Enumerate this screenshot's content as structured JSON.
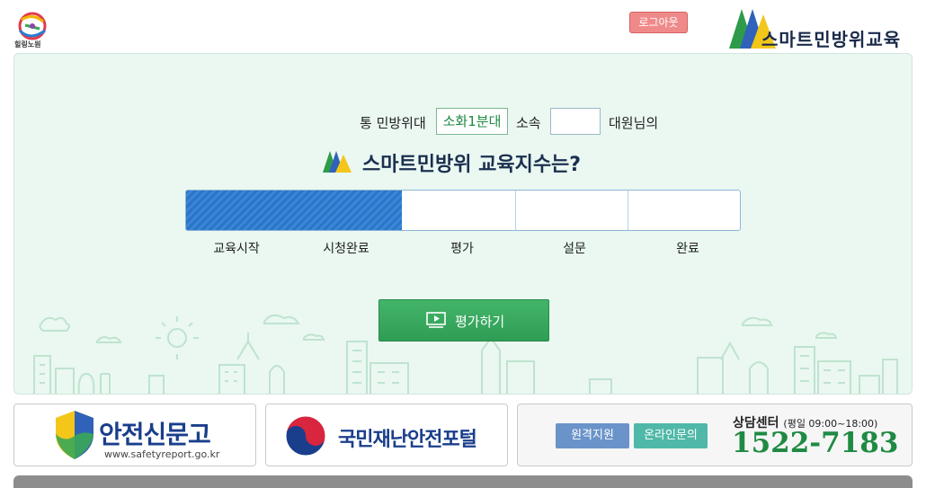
{
  "header": {
    "left_logo_text": "힐링노원",
    "logout_label": "로그아웃",
    "brand_title": "스마트민방위교육"
  },
  "info": {
    "prefix": "통 민방위대",
    "unit": "소화1분대",
    "affil": "소속",
    "name_value": "",
    "suffix": "대원님의"
  },
  "headline": "스마트민방위 교육지수는?",
  "progress": {
    "fraction": 0.39,
    "steps": [
      "교육시작",
      "시청완료",
      "평가",
      "설문",
      "완료"
    ]
  },
  "action": {
    "eval_label": "평가하기"
  },
  "banners": {
    "safety": {
      "title": "안전신문고",
      "url": "www.safetyreport.go.kr"
    },
    "portal": {
      "title": "국민재난안전포털"
    },
    "center": {
      "remote_label": "원격지원",
      "inquiry_label": "온라인문의",
      "title": "상담센터",
      "hours": "(평일 09:00~18:00)",
      "phone": "1522-7183"
    }
  },
  "colors": {
    "accent_green": "#1f8a43",
    "progress_blue": "#2a75c8",
    "logout_pink": "#f08a8a",
    "panel_bg": "#eaf8f1"
  }
}
